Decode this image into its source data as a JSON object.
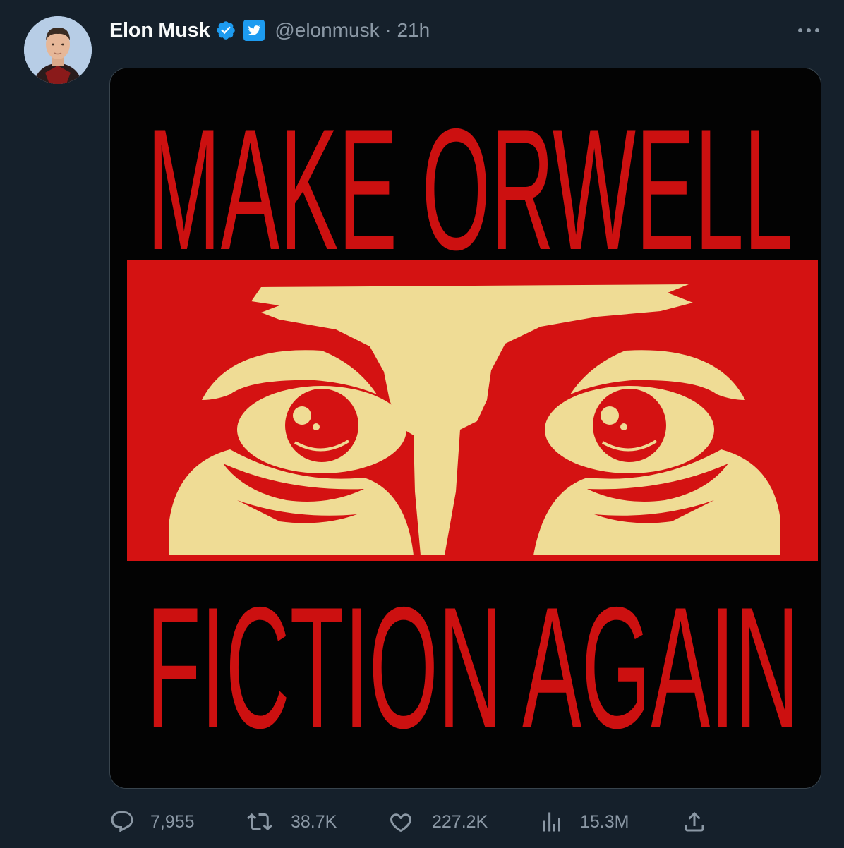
{
  "tweet": {
    "author_name": "Elon Musk",
    "handle_time": "@elonmusk · 21h",
    "media_alt_text": {
      "line1": "MAKE ORWELL",
      "line2": "FICTION AGAIN"
    }
  },
  "actions": {
    "replies": "7,955",
    "retweets": "38.7K",
    "likes": "227.2K",
    "views": "15.3M"
  },
  "icons": {
    "verified": "verified-badge-icon",
    "affiliation": "twitter-bird-icon",
    "more": "more-dots-icon",
    "reply": "reply-icon",
    "retweet": "retweet-icon",
    "like": "heart-icon",
    "views": "views-chart-icon",
    "share": "share-icon"
  },
  "colors": {
    "background": "#15202b",
    "verified_blue": "#1d9bf0",
    "poster_red": "#cc1010",
    "poster_cream": "#efdc95",
    "muted_text": "#8b98a5"
  }
}
